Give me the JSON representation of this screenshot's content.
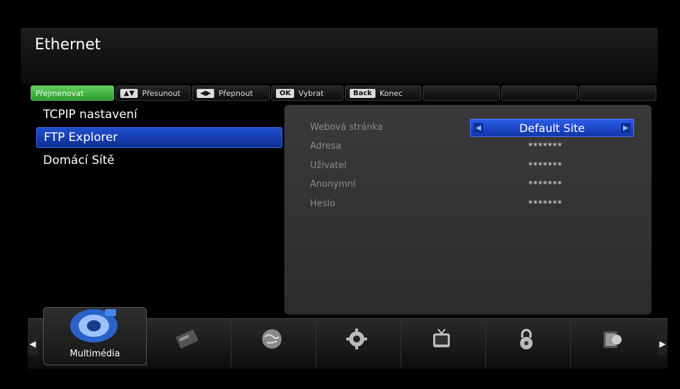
{
  "header": {
    "title": "Ethernet"
  },
  "hints": {
    "rename": "Přejmenovat",
    "move_key": "▲▼",
    "move_label": "Přesunout",
    "switch_key": "◀▶",
    "switch_label": "Přepnout",
    "ok_key": "OK",
    "ok_label": "Vybrat",
    "back_key": "Back",
    "back_label": "Konec"
  },
  "menu": {
    "items": [
      {
        "label": "TCPIP nastavení"
      },
      {
        "label": "FTP Explorer",
        "selected": true
      },
      {
        "label": "Domácí Sítě"
      }
    ]
  },
  "details": {
    "fields": [
      {
        "label": "Webová stránka",
        "value": "Default Site"
      },
      {
        "label": "Adresa",
        "value": "*******"
      },
      {
        "label": "Uživatel",
        "value": "*******"
      },
      {
        "label": "Anonymní",
        "value": "*******"
      },
      {
        "label": "Heslo",
        "value": "*******"
      }
    ]
  },
  "dock": {
    "active_label": "Multimédia",
    "icons": [
      "multimedia-icon",
      "card-icon",
      "globe-icon",
      "gear-icon",
      "tv-icon",
      "lock-icon",
      "book-icon"
    ]
  },
  "colors": {
    "selection_blue": "#1f4fd0",
    "hint_green": "#4cbb4c",
    "panel_gray": "#333333"
  }
}
